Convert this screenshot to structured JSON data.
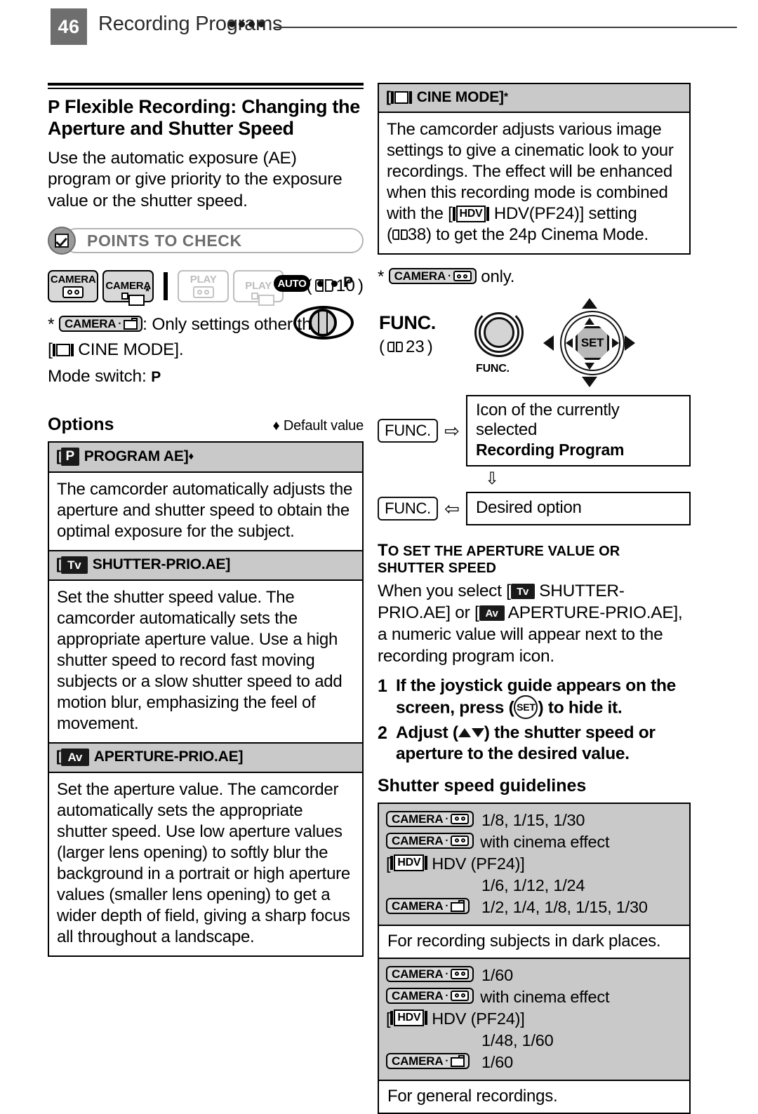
{
  "header": {
    "page_number": "46",
    "title": "Recording Programs",
    "dots_count": 4
  },
  "left": {
    "section_title_icon": "P",
    "section_title": "Flexible Recording: Changing the Aperture and Shutter Speed",
    "intro": "Use the automatic exposure (AE) program or give priority to the exposure value or the shutter speed.",
    "points_to_check": {
      "label": "POINTS TO CHECK",
      "icon": "checkbox-icon",
      "modes": [
        {
          "name": "CAMERA",
          "media": "tape",
          "enabled": true,
          "asterisk": false
        },
        {
          "name": "CAMERA",
          "media": "card",
          "enabled": true,
          "asterisk": true
        },
        {
          "name": "PLAY",
          "media": "tape",
          "enabled": false,
          "asterisk": false
        },
        {
          "name": "PLAY",
          "media": "card",
          "enabled": false,
          "asterisk": false
        }
      ],
      "xref": "10",
      "footnote_prefix": "*",
      "footnote_badge": "CAMERA",
      "footnote_text": ": Only settings other than",
      "footnote_text2_open": "[",
      "footnote_text2": "CINE MODE].",
      "mode_switch_label": "Mode switch:",
      "mode_switch_value": "P"
    },
    "mode_switch_art": {
      "auto_label": "AUTO",
      "p_label": "P"
    },
    "options": {
      "title": "Options",
      "default_marker": "♦",
      "default_note": "Default value",
      "entries": [
        {
          "icon": "P",
          "icon_type": "p",
          "name": "PROGRAM AE",
          "is_default": true,
          "body": "The camcorder automatically adjusts the aperture and shutter speed to obtain the optimal exposure for the subject."
        },
        {
          "icon": "Tv",
          "icon_type": "tv",
          "name": "SHUTTER-PRIO.AE",
          "is_default": false,
          "body": "Set the shutter speed value. The camcorder automatically sets the appropriate aperture value. Use a high shutter speed to record fast moving subjects or a slow shutter speed to add motion blur, emphasizing the feel of movement."
        },
        {
          "icon": "Av",
          "icon_type": "av",
          "name": "APERTURE-PRIO.AE",
          "is_default": false,
          "body": "Set the aperture value. The camcorder automatically sets the appropriate shutter speed. Use low aperture values (larger lens opening) to softly blur the background in a portrait or high aperture values (smaller lens opening) to get a wider depth of field, giving a sharp focus all throughout a landscape."
        }
      ]
    }
  },
  "right": {
    "cine_mode": {
      "icon": "film-icon",
      "name": "CINE MODE",
      "asterisk": "*",
      "body_part1": "The camcorder adjusts various image settings to give a cinematic look to your recordings. The effect will be enhanced when this recording mode is combined with the [",
      "hdv_badge": "HDV",
      "body_part2": "HDV(PF24)] setting",
      "body_part3": "38) to get the 24p Cinema Mode."
    },
    "only_note": {
      "star": "*",
      "badge": "CAMERA",
      "text": "only."
    },
    "func": {
      "label": "FUNC.",
      "xref": "23",
      "button_caption": "FUNC.",
      "joystick_center": "SET"
    },
    "flow": {
      "key1": "FUNC.",
      "arrow1": "⇨",
      "box1_line1": "Icon of the currently selected",
      "box1_line2": "Recording Program",
      "arrow_down": "⇩",
      "key2": "FUNC.",
      "arrow2": "⇦",
      "box2": "Desired option"
    },
    "to_set": {
      "heading_first": "T",
      "heading_rest": "O SET THE APERTURE VALUE OR SHUTTER SPEED",
      "body_part1": "When you select [",
      "tv_icon": "Tv",
      "body_part2": "SHUTTER-PRIO.AE] or [",
      "av_icon": "Av",
      "body_part3": "APERTURE-PRIO.AE], a numeric value will appear next to the recording program icon."
    },
    "steps": [
      {
        "num": "1",
        "text_part1": "If the joystick guide appears on the screen, press (",
        "key": "SET",
        "text_part2": ") to hide it."
      },
      {
        "num": "2",
        "text_part1": "Adjust (",
        "key": "updown-arrows",
        "text_part2": ") the shutter speed or aperture to the desired value."
      }
    ],
    "guidelines": {
      "title": "Shutter speed guidelines",
      "blocks": [
        {
          "rows": [
            {
              "badge": "CAMERA",
              "media": "tape",
              "value": "1/8, 1/15, 1/30",
              "type": "badge-value"
            },
            {
              "badge": "CAMERA",
              "media": "tape",
              "value": "with cinema effect",
              "type": "badge-wide"
            },
            {
              "hdv": "HDV",
              "value": "HDV (PF24)]",
              "prefix": "[",
              "type": "hdv"
            },
            {
              "value": "1/6, 1/12, 1/24",
              "type": "indent"
            },
            {
              "badge": "CAMERA",
              "media": "card",
              "value": "1/2, 1/4, 1/8, 1/15, 1/30",
              "type": "badge-value"
            }
          ],
          "caption": "For recording subjects in dark places."
        },
        {
          "rows": [
            {
              "badge": "CAMERA",
              "media": "tape",
              "value": "1/60",
              "type": "badge-value"
            },
            {
              "badge": "CAMERA",
              "media": "tape",
              "value": "with cinema effect",
              "type": "badge-wide"
            },
            {
              "hdv": "HDV",
              "value": "HDV (PF24)]",
              "prefix": "[",
              "type": "hdv"
            },
            {
              "value": "1/48, 1/60",
              "type": "indent"
            },
            {
              "badge": "CAMERA",
              "media": "card",
              "value": "1/60",
              "type": "badge-value"
            }
          ],
          "caption": "For general recordings."
        }
      ]
    }
  }
}
